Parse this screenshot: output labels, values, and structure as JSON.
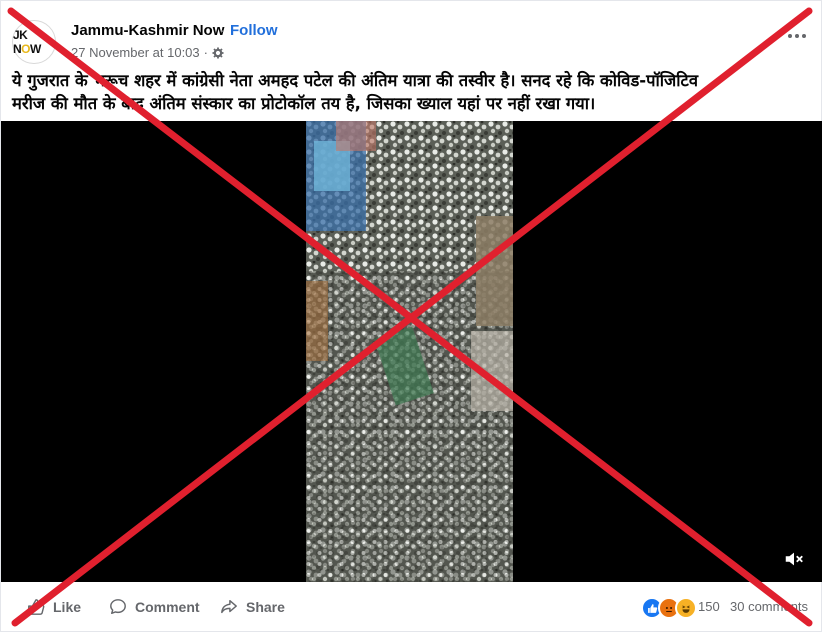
{
  "post": {
    "page_name": "Jammu-Kashmir Now",
    "separator": "·",
    "follow_label": "Follow",
    "timestamp": "27 November at 10:03",
    "meta_separator": "·",
    "privacy_icon": "gear-icon",
    "more_icon": "ellipsis-icon",
    "avatar": {
      "text_jk": "JK N",
      "text_o": "O",
      "text_w": "W"
    },
    "caption_line1": "ये गुजरात के भरूच शहर में कांग्रेसी नेता अमहद पटेल की अंतिम यात्रा की तस्वीर है। सनद रहे कि कोविड-पॉजिटिव",
    "caption_line2": "मरीज की मौत के बाद अंतिम संस्कार का प्रोटोकॉल तय है, जिसका ख्याल यहां पर नहीं रखा गया।"
  },
  "video": {
    "mute_icon": "speaker-muted-icon"
  },
  "actions": {
    "like_label": "Like",
    "comment_label": "Comment",
    "share_label": "Share"
  },
  "engagement": {
    "reactions": [
      "like-reaction-icon",
      "angry-reaction-icon",
      "haha-reaction-icon"
    ],
    "reaction_count": "150",
    "separator": "·",
    "comments": "30 comments"
  },
  "overlay": {
    "color": "#e0202e",
    "type": "red-x-cross"
  },
  "colors": {
    "follow": "#216fdb",
    "muted_text": "#65676b",
    "like": "#1877f2",
    "angry": "#e9710f",
    "haha": "#f7b125"
  }
}
